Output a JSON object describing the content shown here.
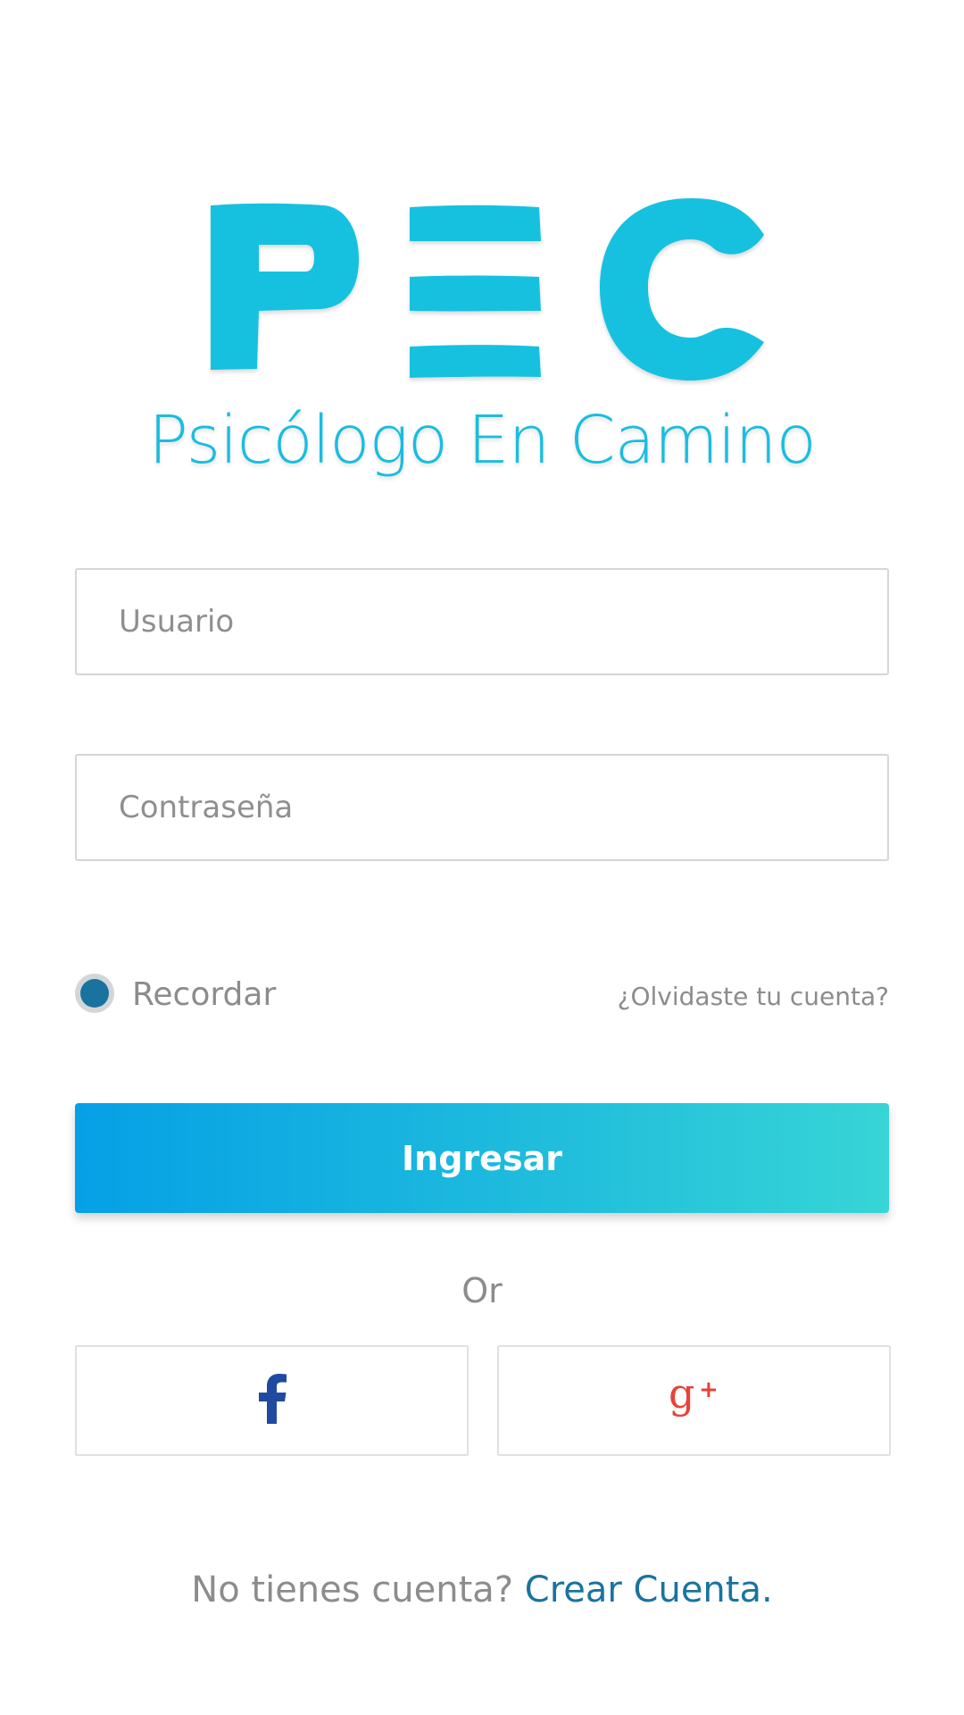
{
  "logo": {
    "letters": "PEC",
    "subtitle": "Psicólogo En Camino"
  },
  "form": {
    "username_placeholder": "Usuario",
    "username_value": "",
    "password_placeholder": "Contraseña",
    "password_value": "",
    "remember_label": "Recordar",
    "remember_checked": true,
    "forgot_label": "¿Olvidaste tu cuenta?",
    "submit_label": "Ingresar"
  },
  "divider_label": "Or",
  "social": {
    "facebook_icon": "facebook-icon",
    "google_icon": "google-plus-icon"
  },
  "signup": {
    "prompt": "No tienes cuenta?",
    "link_label": "Crear Cuenta."
  },
  "colors": {
    "brand": "#19bde0",
    "link": "#1a739f",
    "button_gradient_start": "#05a0e6",
    "button_gradient_end": "#37d5d6",
    "facebook": "#1f4aa0",
    "google": "#e8413a"
  }
}
